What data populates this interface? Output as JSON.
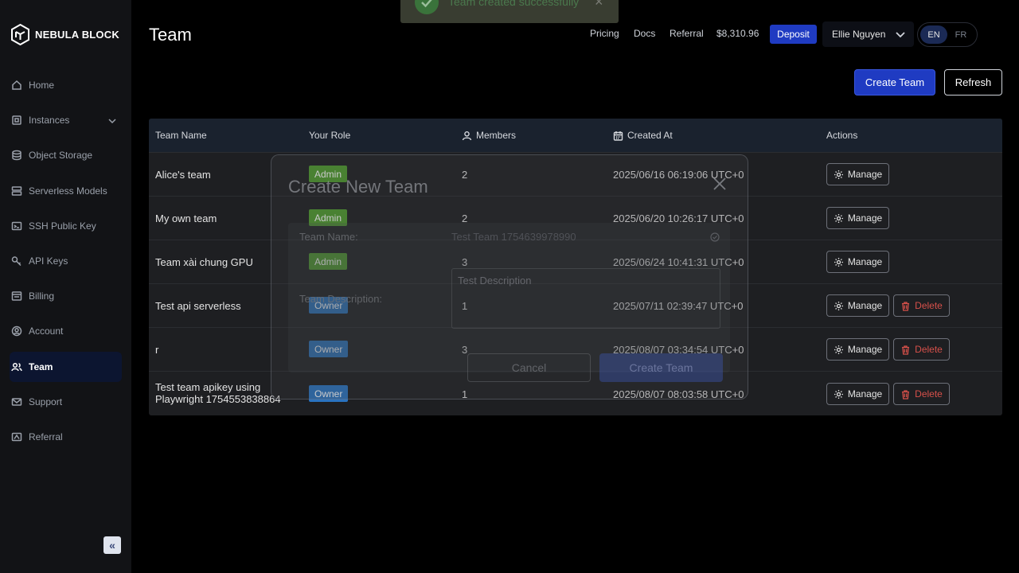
{
  "brand": {
    "name": "NEBULA BLOCK"
  },
  "sidebar": {
    "items": [
      {
        "label": "Home",
        "icon": "home-icon"
      },
      {
        "label": "Instances",
        "icon": "instances-icon"
      },
      {
        "label": "Object Storage",
        "icon": "database-icon"
      },
      {
        "label": "Serverless Models",
        "icon": "server-icon"
      },
      {
        "label": "SSH Public Key",
        "icon": "ssh-key-icon"
      },
      {
        "label": "API Keys",
        "icon": "key-icon"
      },
      {
        "label": "Billing",
        "icon": "billing-icon"
      },
      {
        "label": "Account",
        "icon": "account-icon"
      },
      {
        "label": "Team",
        "icon": "team-icon",
        "active": true
      },
      {
        "label": "Support",
        "icon": "mail-icon"
      },
      {
        "label": "Referral",
        "icon": "referral-icon"
      }
    ],
    "collapse_label": "«"
  },
  "header": {
    "title": "Team",
    "links": [
      "Pricing",
      "Docs",
      "Referral"
    ],
    "balance": "$8,310.96",
    "deposit_label": "Deposit",
    "user_name": "Ellie Nguyen",
    "languages": [
      "EN",
      "FR"
    ],
    "selected_language": "EN"
  },
  "actions": {
    "create_team_label": "Create Team",
    "refresh_label": "Refresh"
  },
  "table": {
    "columns": [
      "Team Name",
      "Your Role",
      "Members",
      "Created At",
      "Actions"
    ],
    "manage_label": "Manage",
    "delete_label": "Delete",
    "rows": [
      {
        "name": "Alice's team",
        "name2": "",
        "role": "Admin",
        "members": "2",
        "created": "2025/06/16 06:19:06 UTC+0",
        "can_delete": false
      },
      {
        "name": "My own team",
        "name2": "",
        "role": "Admin",
        "members": "2",
        "created": "2025/06/20 10:26:17 UTC+0",
        "can_delete": false
      },
      {
        "name": "Team xài chung GPU",
        "name2": "",
        "role": "Admin",
        "members": "3",
        "created": "2025/06/24 10:41:31 UTC+0",
        "can_delete": false
      },
      {
        "name": "Test api serverless",
        "name2": "",
        "role": "Owner",
        "members": "1",
        "created": "2025/07/11 02:39:47 UTC+0",
        "can_delete": true
      },
      {
        "name": "r",
        "name2": "",
        "role": "Owner",
        "members": "3",
        "created": "2025/08/07 03:34:54 UTC+0",
        "can_delete": true
      },
      {
        "name": "Test team apikey using",
        "name2": "Playwright 1754553838864",
        "role": "Owner",
        "members": "1",
        "created": "2025/08/07 08:03:58 UTC+0",
        "can_delete": true
      }
    ]
  },
  "modal": {
    "title": "Create New Team",
    "name_label": "Team Name:",
    "name_value": "Test Team 1754639978990",
    "description_label": "Team Description:",
    "description_value": "Test Description",
    "cancel_label": "Cancel",
    "submit_label": "Create Team"
  },
  "toast": {
    "message": "Team created successfully"
  },
  "colors": {
    "accent": "#1f3bc2",
    "admin": "#4e9c2d",
    "owner": "#2a73c0",
    "danger": "#d6504a"
  }
}
